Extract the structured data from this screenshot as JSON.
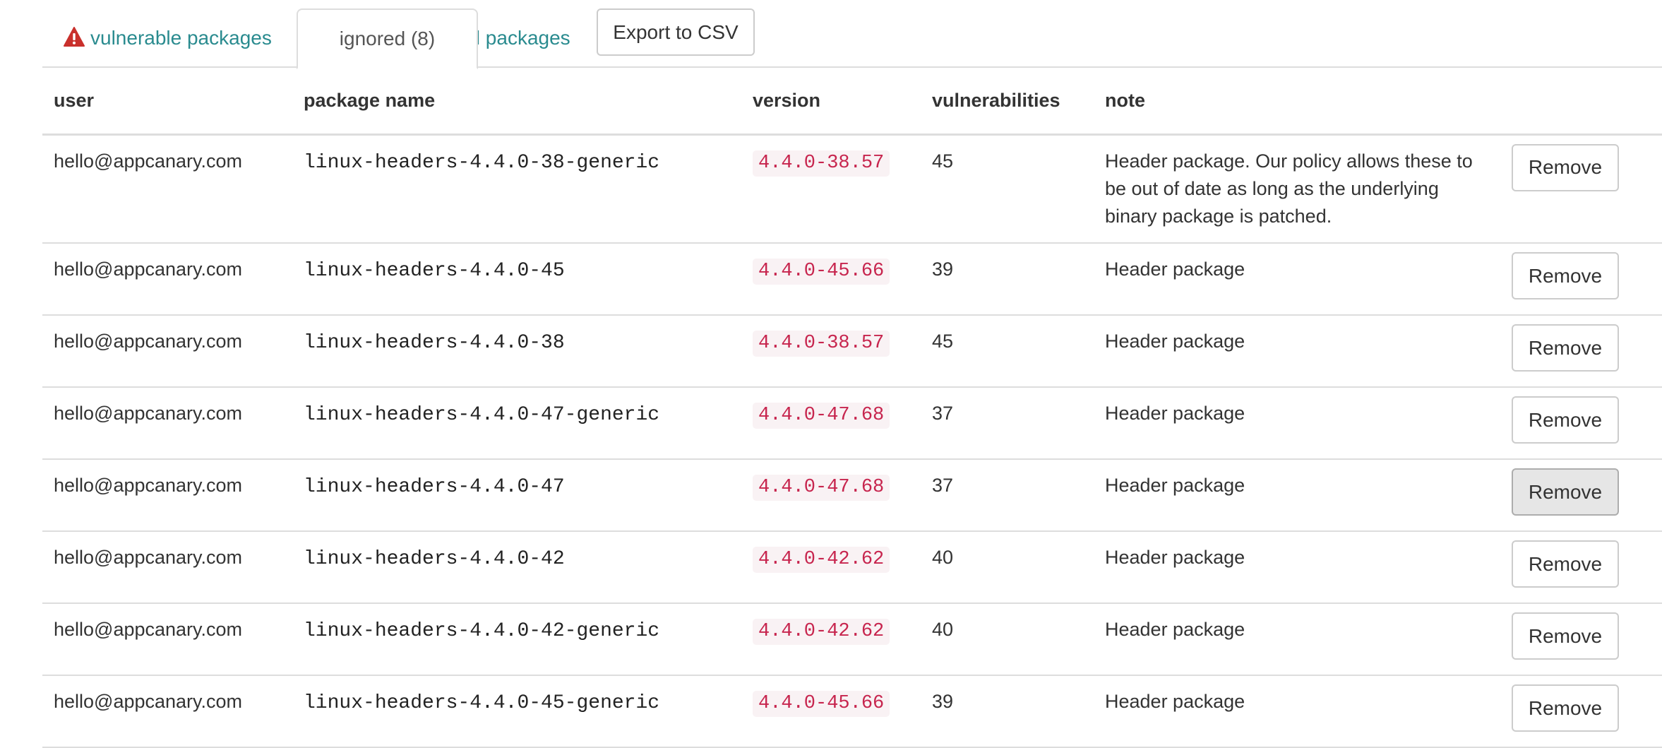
{
  "tabs": {
    "vulnerable_label": "vulnerable packages",
    "ignored_label": "ignored (8)",
    "all_label": "all packages",
    "export_label": "Export to CSV",
    "active": "ignored"
  },
  "colors": {
    "link": "#2a8b8f",
    "warning": "#c9302c",
    "version_text": "#c7254e",
    "version_bg": "#f9f2f4"
  },
  "table": {
    "headers": {
      "user": "user",
      "package": "package name",
      "version": "version",
      "vulnerabilities": "vulnerabilities",
      "note": "note"
    },
    "remove_label": "Remove",
    "rows": [
      {
        "user": "hello@appcanary.com",
        "package": "linux-headers-4.4.0-38-generic",
        "version": "4.4.0-38.57",
        "vulnerabilities": "45",
        "note": "Header package. Our policy allows these to be out of date as long as the underlying binary package is patched."
      },
      {
        "user": "hello@appcanary.com",
        "package": "linux-headers-4.4.0-45",
        "version": "4.4.0-45.66",
        "vulnerabilities": "39",
        "note": "Header package"
      },
      {
        "user": "hello@appcanary.com",
        "package": "linux-headers-4.4.0-38",
        "version": "4.4.0-38.57",
        "vulnerabilities": "45",
        "note": "Header package"
      },
      {
        "user": "hello@appcanary.com",
        "package": "linux-headers-4.4.0-47-generic",
        "version": "4.4.0-47.68",
        "vulnerabilities": "37",
        "note": "Header package"
      },
      {
        "user": "hello@appcanary.com",
        "package": "linux-headers-4.4.0-47",
        "version": "4.4.0-47.68",
        "vulnerabilities": "37",
        "note": "Header package"
      },
      {
        "user": "hello@appcanary.com",
        "package": "linux-headers-4.4.0-42",
        "version": "4.4.0-42.62",
        "vulnerabilities": "40",
        "note": "Header package"
      },
      {
        "user": "hello@appcanary.com",
        "package": "linux-headers-4.4.0-42-generic",
        "version": "4.4.0-42.62",
        "vulnerabilities": "40",
        "note": "Header package"
      },
      {
        "user": "hello@appcanary.com",
        "package": "linux-headers-4.4.0-45-generic",
        "version": "4.4.0-45.66",
        "vulnerabilities": "39",
        "note": "Header package"
      }
    ]
  }
}
